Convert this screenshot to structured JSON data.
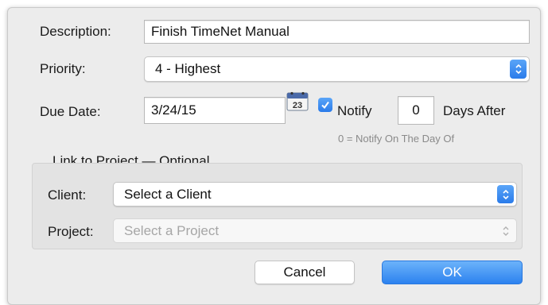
{
  "form": {
    "description_label": "Description:",
    "description_value": "Finish TimeNet Manual",
    "priority_label": "Priority:",
    "priority_value": "4 - Highest",
    "due_date_label": "Due Date:",
    "due_date_value": "3/24/15",
    "calendar_day": "23",
    "notify_checked": true,
    "notify_label": "Notify",
    "notify_days_value": "0",
    "days_after_label": "Days After",
    "notify_note": "0 = Notify On The Day Of"
  },
  "project_link": {
    "group_title": "Link to Project — Optional",
    "client_label": "Client:",
    "client_value": "Select a Client",
    "project_label": "Project:",
    "project_value": "Select a Project",
    "project_enabled": false
  },
  "buttons": {
    "cancel_label": "Cancel",
    "ok_label": "OK"
  },
  "colors": {
    "accent": "#2a7bea",
    "dialog_background": "#ececec",
    "disabled_text": "#a6a6a6"
  },
  "icons": {
    "calendar": "calendar-icon",
    "stepper": "chevron-up-down-icon",
    "checkmark": "checkmark-icon"
  }
}
